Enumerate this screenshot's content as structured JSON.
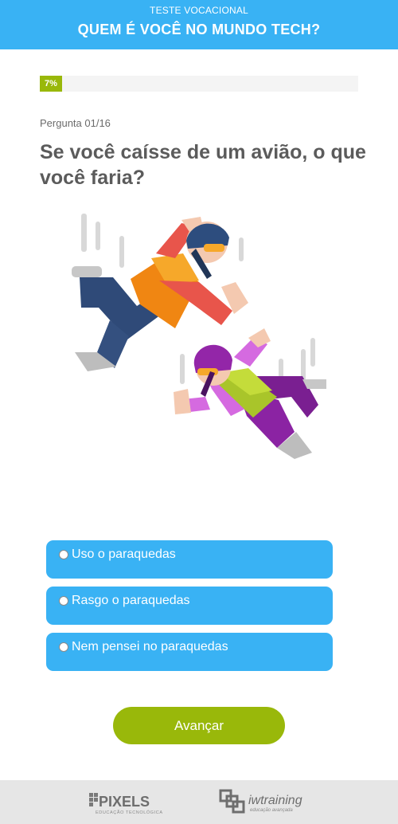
{
  "header": {
    "subtitle": "TESTE VOCACIONAL",
    "title": "QUEM É VOCÊ NO MUNDO TECH?"
  },
  "progress": {
    "label": "7%",
    "value_percent": 7,
    "color": "#99b80a"
  },
  "quiz": {
    "counter": "Pergunta 01/16",
    "question": "Se você caísse de um avião, o que você faria?",
    "options": [
      {
        "label": "Uso o paraquedas"
      },
      {
        "label": "Rasgo o paraquedas"
      },
      {
        "label": "Nem pensei no paraquedas"
      }
    ],
    "advance_label": "Avançar"
  },
  "footer": {
    "logos": [
      {
        "name": "PIXELS",
        "tagline": "EDUCAÇÃO TECNOLÓGICA"
      },
      {
        "name": "iwtraining",
        "tagline": "educação avançada"
      }
    ]
  },
  "colors": {
    "accent_blue": "#39b2f4",
    "accent_green": "#99b80a",
    "footer_bg": "#e6e6e6"
  }
}
